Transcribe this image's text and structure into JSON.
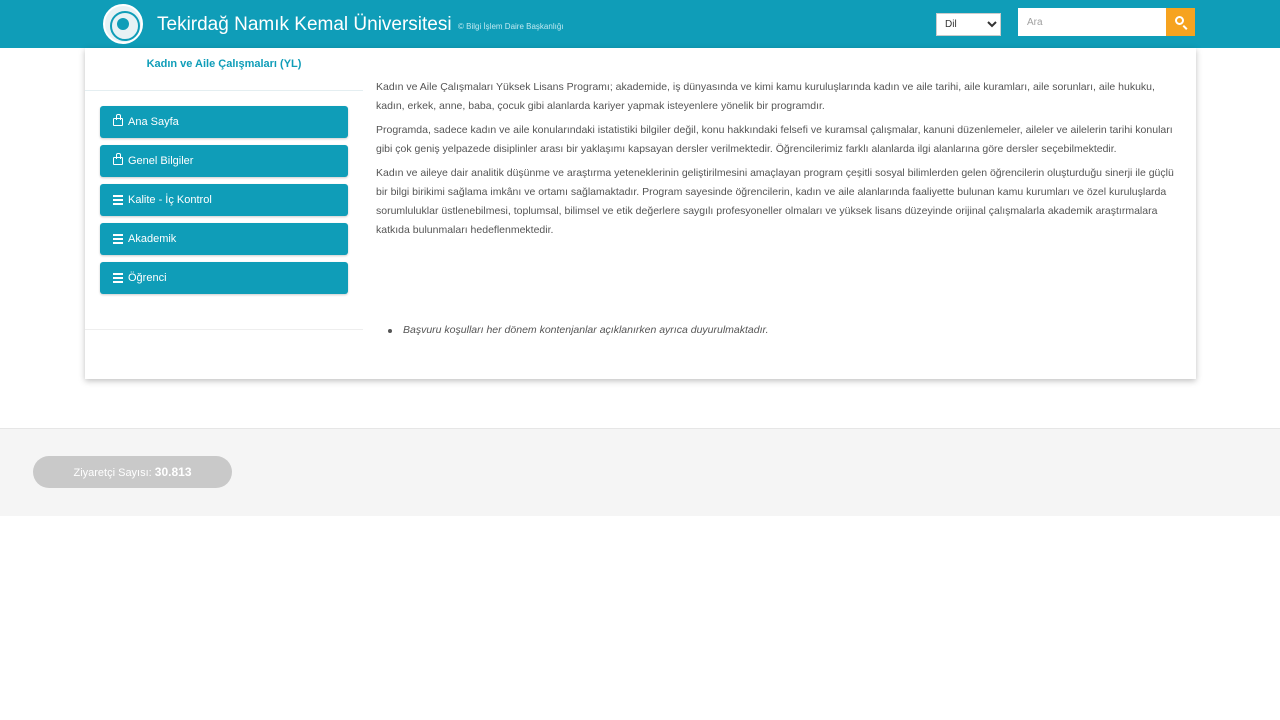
{
  "header": {
    "university_name": "Tekirdağ Namık Kemal Üniversitesi",
    "university_subtitle": "© Bilgi İşlem Daire Başkanlığı",
    "language_selected": "Dil",
    "search_placeholder": "Ara",
    "icons": {
      "logo": "university-seal-logo",
      "search": "search-icon"
    },
    "colors": {
      "topbar": "#0f9db8",
      "search_button": "#f6a31f"
    }
  },
  "sidebar": {
    "title": "Kadın ve Aile Çalışmaları (YL)",
    "items": [
      {
        "label": "Ana Sayfa",
        "icon": "hand-point-icon"
      },
      {
        "label": "Genel Bilgiler",
        "icon": "hand-point-icon"
      },
      {
        "label": "Kalite - İç Kontrol",
        "icon": "list-icon"
      },
      {
        "label": "Akademik",
        "icon": "list-icon"
      },
      {
        "label": "Öğrenci",
        "icon": "list-icon"
      }
    ]
  },
  "content": {
    "paragraphs": [
      "Kadın ve Aile Çalışmaları Yüksek Lisans Programı; akademide, iş dünyasında ve kimi kamu kuruluşlarında kadın ve aile tarihi, aile kuramları, aile sorunları, aile hukuku, kadın, erkek, anne, baba, çocuk gibi alanlarda kariyer yapmak isteyenlere yönelik bir programdır.",
      "Programda, sadece kadın ve aile konularındaki istatistiki bilgiler değil, konu hakkındaki felsefi ve kuramsal çalışmalar, kanuni düzenlemeler, aileler ve ailelerin tarihi konuları gibi çok geniş yelpazede disiplinler arası bir yaklaşımı kapsayan dersler verilmektedir. Öğrencilerimiz farklı alanlarda ilgi alanlarına göre dersler seçebilmektedir.",
      "Kadın ve aileye dair analitik düşünme ve araştırma yeteneklerinin geliştirilmesini amaçlayan program çeşitli sosyal bilimlerden gelen öğrencilerin oluşturduğu sinerji ile güçlü bir bilgi birikimi sağlama imkânı ve ortamı sağlamaktadır. Program sayesinde öğrencilerin, kadın ve aile alanlarında faaliyette bulunan kamu kurumları ve özel kuruluşlarda sorumluluklar üstlenebilmesi, toplumsal, bilimsel ve etik değerlere saygılı profesyoneller olmaları ve yüksek lisans düzeyinde orijinal çalışmalarla akademik araştırmalara katkıda bulunmaları hedeflenmektedir."
    ],
    "note": "Başvuru koşulları her dönem kontenjanlar açıklanırken ayrıca duyurulmaktadır."
  },
  "footer": {
    "visitor_label": "Ziyaretçi Sayısı:",
    "visitor_count": "30.813"
  }
}
